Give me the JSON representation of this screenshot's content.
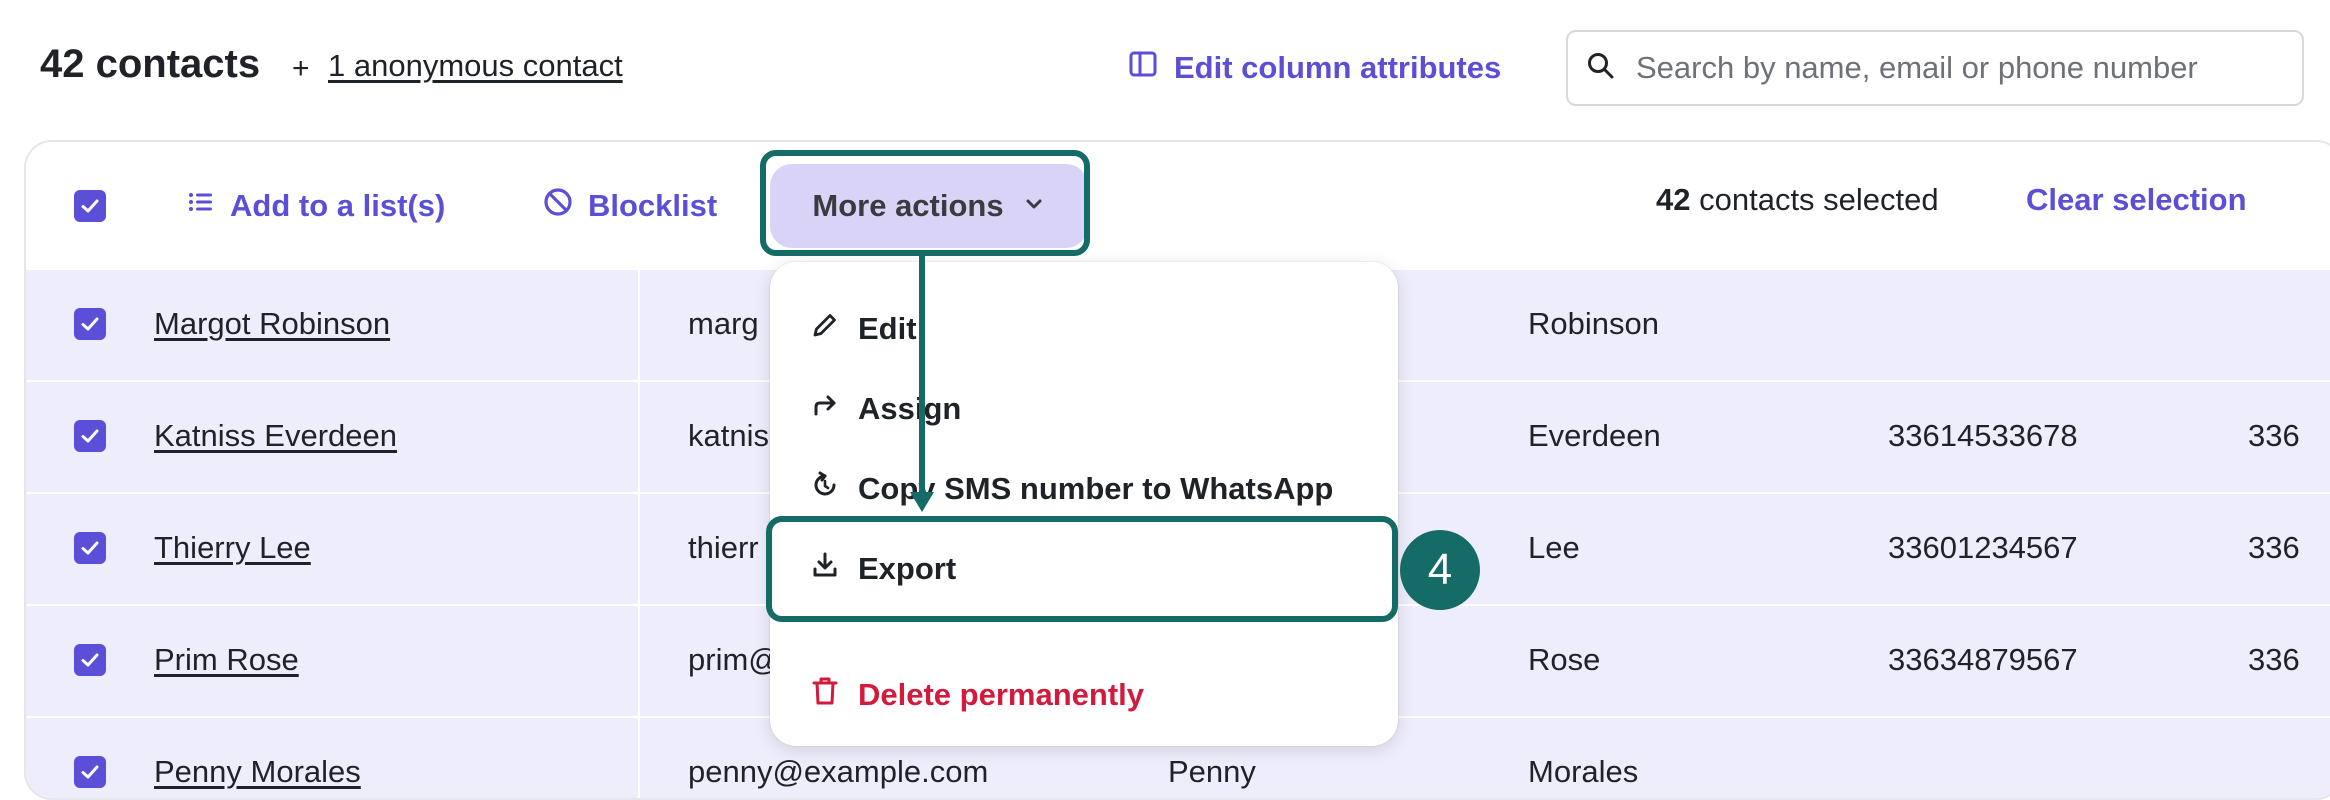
{
  "header": {
    "contacts_count": "42 contacts",
    "plus": "+",
    "anonymous_link": "1 anonymous contact",
    "edit_columns": "Edit column attributes",
    "search_placeholder": "Search by name, email or phone number"
  },
  "toolbar": {
    "add_to_list": "Add to a list(s)",
    "blocklist": "Blocklist",
    "more_actions": "More actions",
    "selected_count": "42",
    "selected_suffix": "contacts selected",
    "clear_selection": "Clear selection"
  },
  "rows": [
    {
      "name": "Margot Robinson",
      "email": "marg",
      "last": "Robinson",
      "phone": "",
      "phone2": ""
    },
    {
      "name": "Katniss Everdeen",
      "email": "katnis",
      "last": "Everdeen",
      "phone": "33614533678",
      "phone2": "336"
    },
    {
      "name": "Thierry Lee",
      "email": "thierr",
      "last": "Lee",
      "phone": "33601234567",
      "phone2": "336"
    },
    {
      "name": "Prim Rose",
      "email": "prim@",
      "last": "Rose",
      "phone": "33634879567",
      "phone2": "336"
    },
    {
      "name": "Penny Morales",
      "email": "penny@example.com",
      "first": "Penny",
      "last": "Morales",
      "phone": "",
      "phone2": ""
    }
  ],
  "dropdown": {
    "items": [
      {
        "label": "Edit",
        "icon": "pencil-icon"
      },
      {
        "label": "Assign",
        "icon": "share-arrow-icon"
      },
      {
        "label": "Copy SMS number to WhatsApp",
        "icon": "whatsapp-sync-icon"
      },
      {
        "label": "Export",
        "icon": "download-icon"
      },
      {
        "label": "Delete permanently",
        "icon": "trash-icon"
      }
    ]
  },
  "annotation": {
    "step_number": "4"
  },
  "colors": {
    "accent": "#5a4fd6",
    "row_selected_bg": "#eeedfb",
    "more_actions_bg": "#d9d4f7",
    "danger": "#d21a3c",
    "annotation": "#156b66"
  }
}
